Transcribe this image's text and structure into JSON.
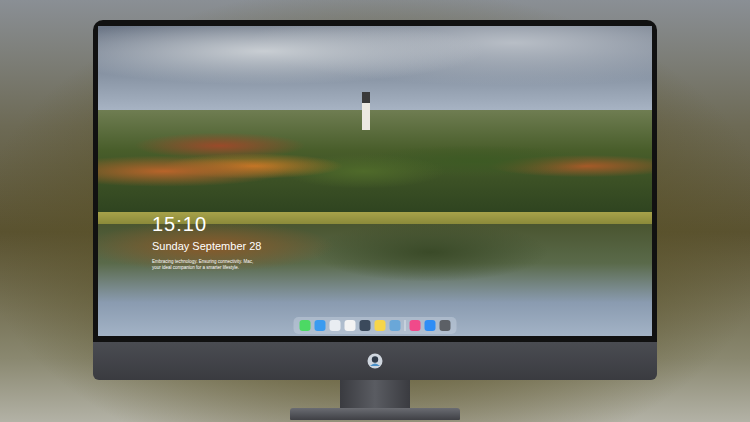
{
  "lock_screen": {
    "time": "15:10",
    "date": "Sunday September 28",
    "tagline": "Embracing technology. Ensuring connectivity. Mac, your ideal companion for a smarter lifestyle."
  }
}
